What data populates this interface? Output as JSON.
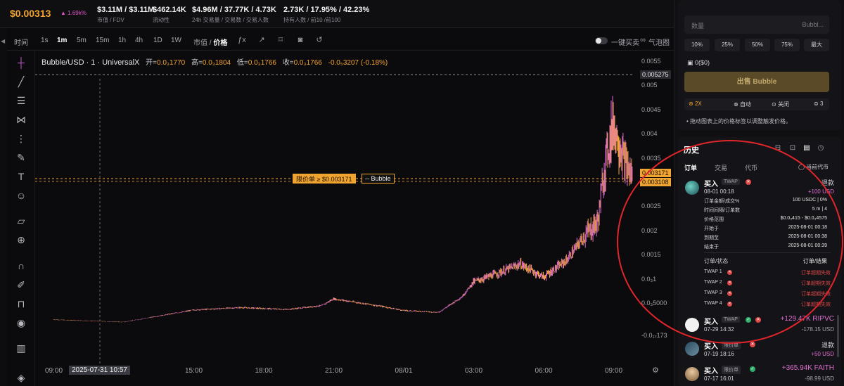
{
  "header": {
    "price": "$0.00313",
    "price_change": "▲ 1.69k%",
    "stats": [
      {
        "value": "$3.11M / $3.11M",
        "label": "市值 / FDV"
      },
      {
        "value": "$462.14K",
        "label": "流动性"
      },
      {
        "value": "$4.96M / 37.77K / 4.73K",
        "label": "24h 交易量 / 交易数 / 交易人数"
      },
      {
        "value": "2.73K / 17.95% / 42.23%",
        "label": "持有人数 / 前10 /前100"
      }
    ]
  },
  "toolbar": {
    "time_label": "时间",
    "intervals": [
      "1s",
      "1m",
      "5m",
      "15m",
      "1h",
      "4h",
      "1D",
      "1W"
    ],
    "active_interval": "1m",
    "mode_left": "市值",
    "mode_sep": " / ",
    "mode_right": "价格",
    "one_click_label": "一键买卖",
    "bubble_label": "气泡图"
  },
  "chart": {
    "symbol": "Bubble/USD · 1 · UniversalX",
    "open_label": "开=",
    "open": "0.0₃1770",
    "high_label": "高=",
    "high": "0.0₃1804",
    "low_label": "低=",
    "low": "0.0₃1766",
    "close_label": "收=",
    "close": "0.0₃1766",
    "change": "-0.0₅3207 (-0.18%)",
    "limit_order_label": "限价单",
    "limit_order_value": "≥ $0.003171",
    "limit_order_token": "-- Bubble",
    "price_tag_top": "0.005275",
    "price_tag_limit": "0.003171",
    "price_tag_current": "0.003108",
    "cursor_time": "2025-07-31  10:57",
    "tv_logo": "17",
    "y_labels": [
      "0.0055",
      "0.005",
      "0.0045",
      "0.004",
      "0.0035",
      "0.003",
      "0.0025",
      "0.002",
      "0.0015",
      "0.0₃1",
      "0.0₃5000",
      "-0.0₁₇173"
    ],
    "x_labels": [
      "09:00",
      "15:00",
      "18:00",
      "21:00",
      "08/01",
      "03:00",
      "06:00",
      "09:00"
    ]
  },
  "chart_data": {
    "type": "line",
    "title": "Bubble/USD · 1 · UniversalX",
    "xlabel": "",
    "ylabel": "",
    "x": [
      "07-31 09:00",
      "07-31 12:00",
      "07-31 15:00",
      "07-31 17:00",
      "07-31 19:00",
      "07-31 20:30",
      "07-31 21:00",
      "07-31 23:00",
      "08-01 00:00",
      "08-01 01:30",
      "08-01 02:30",
      "08-01 03:00",
      "08-01 04:00",
      "08-01 05:00",
      "08-01 06:00",
      "08-01 07:00",
      "08-01 07:40",
      "08-01 08:20",
      "08-01 08:40",
      "08-01 09:00",
      "08-01 09:30",
      "08-01 09:50"
    ],
    "series": [
      {
        "values": [
          0.00017,
          0.00012,
          0.00037,
          0.00042,
          0.00038,
          0.00046,
          0.0006,
          0.00045,
          0.00036,
          0.00032,
          0.00064,
          0.00095,
          0.00112,
          0.00132,
          0.00105,
          0.0014,
          0.00185,
          0.0022,
          0.0035,
          0.0042,
          0.0034,
          0.0031
        ]
      }
    ],
    "ylim": [
      -0.00017,
      0.0055
    ],
    "grid": false
  },
  "right": {
    "qty_placeholder": "数量",
    "qty_unit": "Bubbl...",
    "pct_buttons": [
      "10%",
      "25%",
      "50%",
      "75%",
      "最大"
    ],
    "balance": "0($0)",
    "sell_button": "出售 Bubble",
    "options": [
      "2X",
      "自动",
      "关闭",
      "3"
    ],
    "hint": "拖动图表上的价格标签以调整触发价格。"
  },
  "history": {
    "title": "历史",
    "tabs": [
      "订单",
      "交易",
      "代币"
    ],
    "current_coin": "当前代币",
    "order1": {
      "side": "买入",
      "badge": "TWAP",
      "status": "退款",
      "time": "08-01 00:18",
      "amount": "+100 USD",
      "kv": [
        {
          "k": "订单金额/成交%",
          "v": "100 USDC | 0%"
        },
        {
          "k": "时间间隔/订单数",
          "v": "5 m | 4"
        },
        {
          "k": "价格范围",
          "v": "$0.0₃415 - $0.0₃4575"
        },
        {
          "k": "开始于",
          "v": "2025-08-01 00:18"
        },
        {
          "k": "到期至",
          "v": "2025-08-01 00:38"
        },
        {
          "k": "结束于",
          "v": "2025-08-01 00:39"
        }
      ],
      "sub_header_left": "订单/状态",
      "sub_header_right": "订单/结果",
      "sub_orders": [
        {
          "name": "TWAP 1",
          "result": "订单超期失效"
        },
        {
          "name": "TWAP 2",
          "result": "订单超期失效"
        },
        {
          "name": "TWAP 3",
          "result": "订单超期失效"
        },
        {
          "name": "TWAP 4",
          "result": "订单超期失效"
        }
      ]
    },
    "order2": {
      "side": "买入",
      "badge": "TWAP",
      "time": "07-29 14:32",
      "big": "+129.47K RIPVC",
      "sub": "-178.15 USD"
    },
    "order3": {
      "side": "买入",
      "badge": "限价单",
      "time": "07-19 18:16",
      "status": "退款",
      "amount": "+50 USD"
    },
    "order4": {
      "side": "买入",
      "badge": "限价单",
      "time": "07-17 16:01",
      "big": "+365.94K FAITH",
      "sub": "-98.99 USD"
    }
  },
  "colors": {
    "accent": "#f1a430",
    "candle_up": "#e26ed0",
    "candle_down": "#f1a430",
    "refund": "#e26ed0",
    "error": "#e04848",
    "annotation": "#e0262a"
  }
}
